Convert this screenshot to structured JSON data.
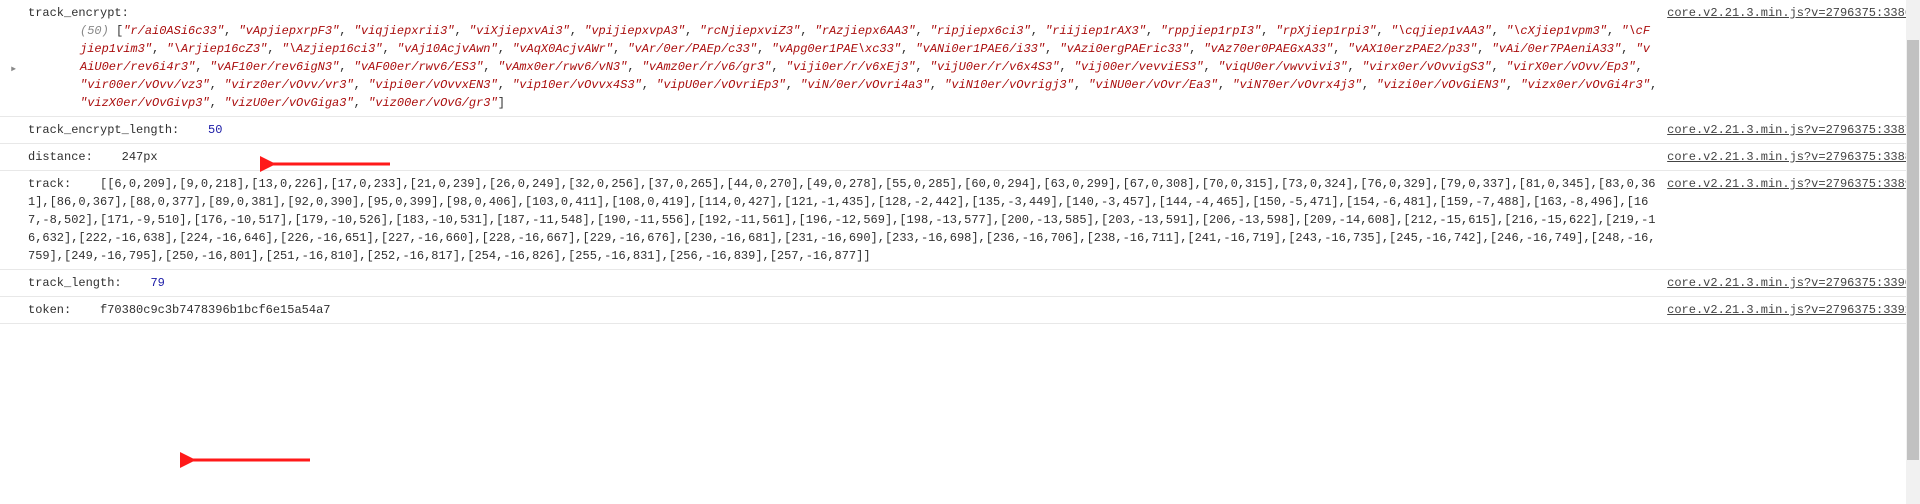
{
  "rows": {
    "track_encrypt": {
      "label": "track_encrypt:",
      "count_prefix": "(50)",
      "items": [
        "\"r/ai0ASi6c33\"",
        "\"vApjiepxrpF3\"",
        "\"viqjiepxrii3\"",
        "\"viXjiepxvAi3\"",
        "\"vpijiepxvpA3\"",
        "\"rcNjiepxviZ3\"",
        "\"rAzjiepx6AA3\"",
        "\"ripjiepx6ci3\"",
        "\"riijiep1rAX3\"",
        "\"rppjiep1rpI3\"",
        "\"rpXjiep1rpi3\"",
        "\"\\cqjiep1vAA3\"",
        "\"\\cXjiep1vpm3\"",
        "\"\\cFjiep1vim3\"",
        "\"\\Arjiep16cZ3\"",
        "\"\\Azjiep16ci3\"",
        "\"vAj10AcjvAwn\"",
        "\"vAqX0AcjvAWr\"",
        "\"vAr/0er/PAEp/c33\"",
        "\"vApg0er1PAE\\xc33\"",
        "\"vANi0er1PAE6/i33\"",
        "\"vAzi0ergPAEric33\"",
        "\"vAz70er0PAEGxA33\"",
        "\"vAX10erzPAE2/p33\"",
        "\"vAi/0er7PAeniA33\"",
        "\"vAiU0er/rev6i4r3\"",
        "\"vAF10er/rev6igN3\"",
        "\"vAF00er/rwv6/ES3\"",
        "\"vAmx0er/rwv6/vN3\"",
        "\"vAmz0er/r/v6/gr3\"",
        "\"viji0er/r/v6xEj3\"",
        "\"vijU0er/r/v6x4S3\"",
        "\"vij00er/vevviES3\"",
        "\"viqU0er/vwvvivi3\"",
        "\"virx0er/vOvvigS3\"",
        "\"virX0er/vOvv/Ep3\"",
        "\"vir00er/vOvv/vz3\"",
        "\"virz0er/vOvv/vr3\"",
        "\"vipi0er/vOvvxEN3\"",
        "\"vip10er/vOvvx4S3\"",
        "\"vipU0er/vOvriEp3\"",
        "\"viN/0er/vOvri4a3\"",
        "\"viN10er/vOvrigj3\"",
        "\"viNU0er/vOvr/Ea3\"",
        "\"viN70er/vOvrx4j3\"",
        "\"vizi0er/vOvGiEN3\"",
        "\"vizx0er/vOvGi4r3\"",
        "\"vizX0er/vOvGivp3\"",
        "\"vizU0er/vOvGiga3\"",
        "\"viz00er/vOvG/gr3\""
      ],
      "src": "core.v2.21.3.min.js?v=2796375:3386"
    },
    "track_encrypt_length": {
      "label": "track_encrypt_length:",
      "value": "50",
      "src": "core.v2.21.3.min.js?v=2796375:3387"
    },
    "distance": {
      "label": "distance:",
      "value": "247px",
      "src": "core.v2.21.3.min.js?v=2796375:3388"
    },
    "track": {
      "label": "track:",
      "value": "[[6,0,209],[9,0,218],[13,0,226],[17,0,233],[21,0,239],[26,0,249],[32,0,256],[37,0,265],[44,0,270],[49,0,278],[55,0,285],[60,0,294],[63,0,299],[67,0,308],[70,0,315],[73,0,324],[76,0,329],[79,0,337],[81,0,345],[83,0,361],[86,0,367],[88,0,377],[89,0,381],[92,0,390],[95,0,399],[98,0,406],[103,0,411],[108,0,419],[114,0,427],[121,-1,435],[128,-2,442],[135,-3,449],[140,-3,457],[144,-4,465],[150,-5,471],[154,-6,481],[159,-7,488],[163,-8,496],[167,-8,502],[171,-9,510],[176,-10,517],[179,-10,526],[183,-10,531],[187,-11,548],[190,-11,556],[192,-11,561],[196,-12,569],[198,-13,577],[200,-13,585],[203,-13,591],[206,-13,598],[209,-14,608],[212,-15,615],[216,-15,622],[219,-16,632],[222,-16,638],[224,-16,646],[226,-16,651],[227,-16,660],[228,-16,667],[229,-16,676],[230,-16,681],[231,-16,690],[233,-16,698],[236,-16,706],[238,-16,711],[241,-16,719],[243,-16,735],[245,-16,742],[246,-16,749],[248,-16,759],[249,-16,795],[250,-16,801],[251,-16,810],[252,-16,817],[254,-16,826],[255,-16,831],[256,-16,839],[257,-16,877]]",
      "src": "core.v2.21.3.min.js?v=2796375:3389"
    },
    "track_length": {
      "label": "track_length:",
      "value": "79",
      "src": "core.v2.21.3.min.js?v=2796375:3390"
    },
    "token": {
      "label": "token:",
      "value": "f70380c9c3b7478396b1bcf6e15a54a7",
      "src": "core.v2.21.3.min.js?v=2796375:3391"
    }
  },
  "annotation_color": "#ff1a1a"
}
